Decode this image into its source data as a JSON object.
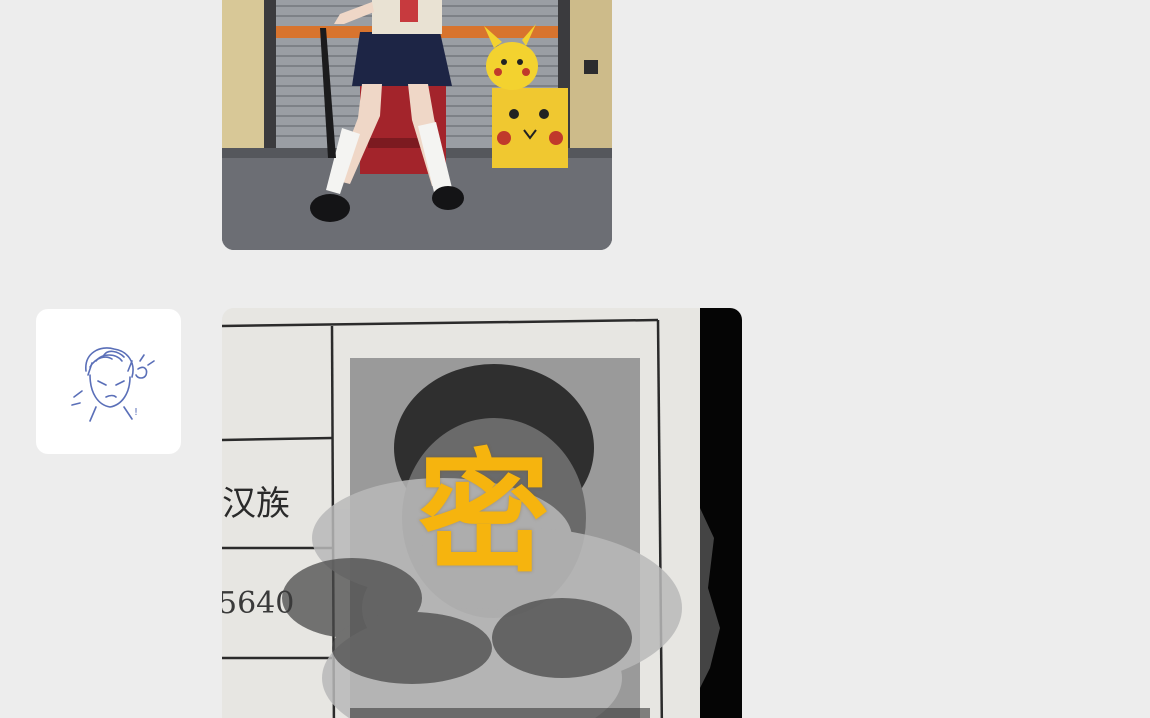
{
  "chat": {
    "messages": [
      {
        "type": "image",
        "content": "photo",
        "icon": "photo-icon"
      },
      {
        "type": "image",
        "content": "document",
        "sender_avatar": "avatar-sketch-icon",
        "document_text": {
          "ethnicity_fragment": "汉族",
          "id_number_fragment": "5640"
        },
        "overlay_mark": "密",
        "overlay_color": "#f6b40e"
      }
    ]
  },
  "colors": {
    "background": "#ededed",
    "bubble_radius_style": "rounded"
  }
}
